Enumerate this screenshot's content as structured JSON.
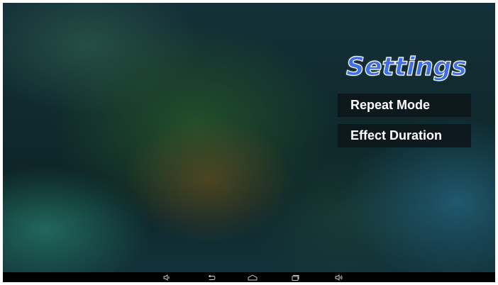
{
  "settings": {
    "title": "Settings",
    "items": [
      {
        "label": "Repeat Mode"
      },
      {
        "label": "Effect Duration"
      }
    ]
  },
  "navbar": {
    "buttons": [
      {
        "icon": "volume-down-icon"
      },
      {
        "icon": "back-icon"
      },
      {
        "icon": "home-icon"
      },
      {
        "icon": "recent-apps-icon"
      },
      {
        "icon": "volume-up-icon"
      }
    ]
  },
  "colors": {
    "title_fill": "#3f6fe6",
    "title_outline": "#ffffff",
    "menu_background": "#0c161a",
    "navbar_background": "#000000"
  }
}
